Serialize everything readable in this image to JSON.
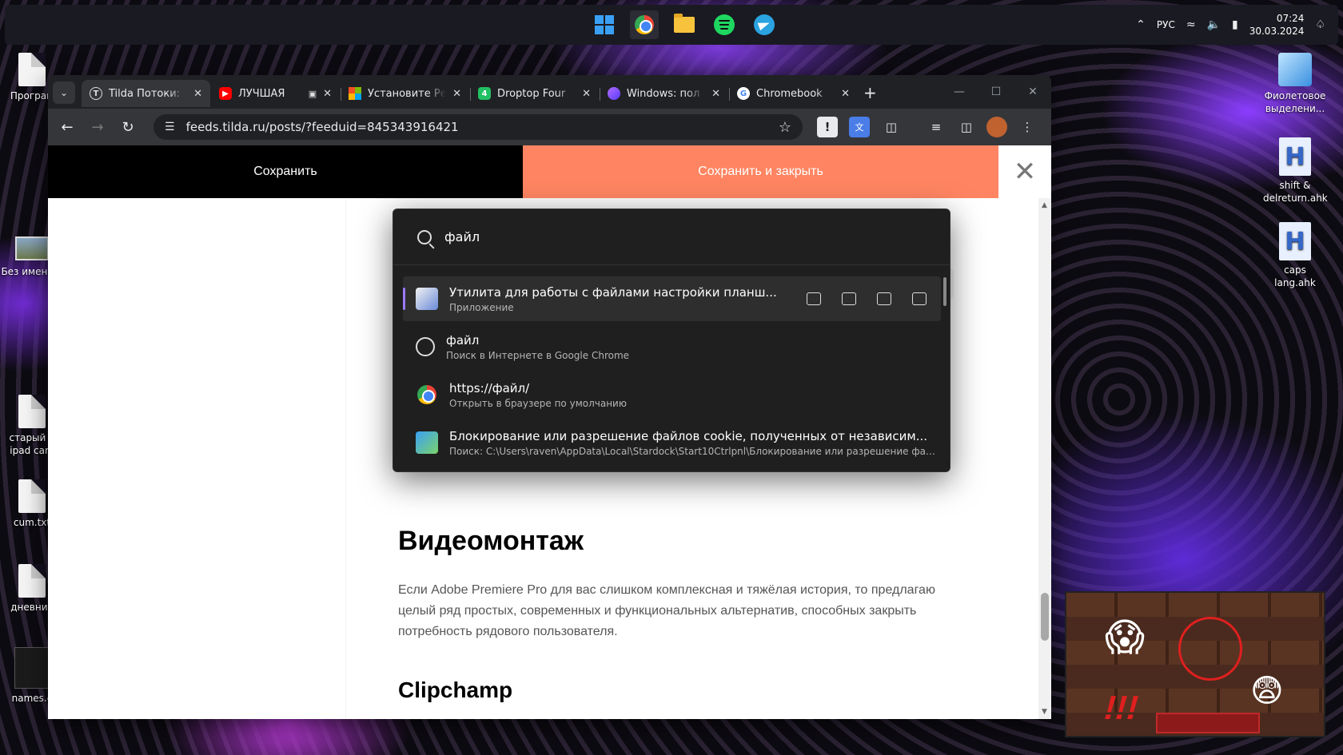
{
  "taskbar": {
    "apps": [
      "start-button",
      "chrome",
      "file-explorer",
      "spotify",
      "telegram"
    ],
    "language": "РУС",
    "time": "07:24",
    "date": "30.03.2024"
  },
  "desktop": {
    "left_icons": [
      {
        "label": "Програм"
      },
      {
        "label": "Без имени.p"
      },
      {
        "label": "старый a ipad cam"
      },
      {
        "label": "cum.txt"
      },
      {
        "label": "дневник"
      },
      {
        "label": "names.c"
      }
    ],
    "right_icons": [
      {
        "label": "Фиолетовое выделени..."
      },
      {
        "label": "shift & delreturn.ahk"
      },
      {
        "label": "caps lang.ahk"
      }
    ]
  },
  "browser": {
    "tabs": [
      {
        "title": "Tilda Потоки: ",
        "favicon": "tilda",
        "active": true
      },
      {
        "title": "ЛУЧШАЯ ",
        "favicon": "youtube",
        "active": false
      },
      {
        "title": "Установите Ре",
        "favicon": "microsoft",
        "active": false
      },
      {
        "title": "Droptop Four",
        "favicon": "droptop",
        "active": false
      },
      {
        "title": "Windows: пол",
        "favicon": "windows-blog",
        "active": false
      },
      {
        "title": "Chromebook ",
        "favicon": "google",
        "active": false
      }
    ],
    "url": "feeds.tilda.ru/posts/?feeduid=845343916421"
  },
  "editor": {
    "save_label": "Сохранить",
    "save_close_label": "Сохранить и закрыть"
  },
  "article": {
    "heading": "Видеомонтаж",
    "paragraph": "Если Adobe Premiere Pro для вас слишком комплексная и тяжёлая история, то предлагаю целый ряд простых, современных и функциональных альтернатив, способных закрыть потребность рядового пользователя.",
    "subheading": "Clipchamp"
  },
  "search_popup": {
    "query": "файл",
    "results": [
      {
        "title": "Утилита для работы с файлами настройки планш...",
        "subtitle": "Приложение",
        "icon": "app-utility-icon",
        "selected": true
      },
      {
        "title": "файл",
        "subtitle": "Поиск в Интернете в Google Chrome",
        "icon": "web-search-icon",
        "selected": false
      },
      {
        "title": "https://файл/",
        "subtitle": "Открыть в браузере по умолчанию",
        "icon": "chrome-icon",
        "selected": false
      },
      {
        "title": "Блокирование или разрешение файлов cookie, полученных от независим...",
        "subtitle": "Поиск: C:\\Users\\raven\\AppData\\Local\\Stardock\\Start10Ctrlpnl\\Блокирование или разрешение файло...",
        "icon": "control-panel-icon",
        "selected": false
      }
    ]
  },
  "colors": {
    "accent_orange": "#ff8562",
    "selection_accent": "#9b7bff",
    "chrome_dark": "#35363a"
  }
}
